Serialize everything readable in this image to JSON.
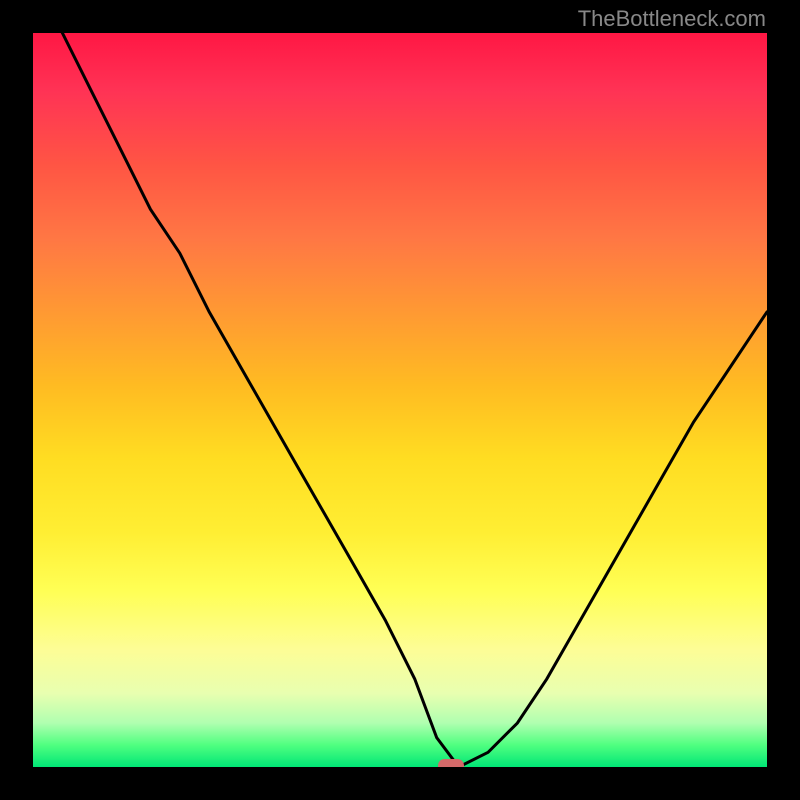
{
  "watermark": "TheBottleneck.com",
  "chart_data": {
    "type": "line",
    "title": "",
    "xlabel": "",
    "ylabel": "",
    "xlim": [
      0,
      100
    ],
    "ylim": [
      0,
      100
    ],
    "grid": false,
    "legend": false,
    "background_gradient": {
      "top_color": "#ff1744",
      "bottom_color": "#00e676",
      "description": "vertical gradient red-to-green representing bottleneck severity"
    },
    "marker": {
      "x": 57,
      "y": 0,
      "color": "#d46a6a",
      "shape": "rounded-rect"
    },
    "series": [
      {
        "name": "bottleneck-curve",
        "color": "#000000",
        "x": [
          0,
          4,
          8,
          12,
          16,
          20,
          24,
          28,
          32,
          36,
          40,
          44,
          48,
          52,
          55,
          58,
          62,
          66,
          70,
          74,
          78,
          82,
          86,
          90,
          94,
          98,
          100
        ],
        "values": [
          108,
          100,
          92,
          84,
          76,
          70,
          62,
          55,
          48,
          41,
          34,
          27,
          20,
          12,
          4,
          0,
          2,
          6,
          12,
          19,
          26,
          33,
          40,
          47,
          53,
          59,
          62
        ]
      }
    ]
  }
}
